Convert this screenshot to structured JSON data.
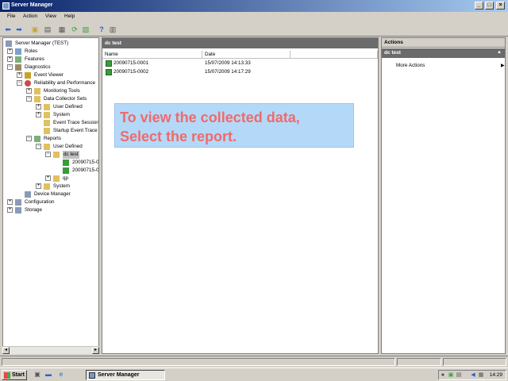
{
  "window": {
    "title": "Server Manager",
    "minimize": "_",
    "maximize": "□",
    "close": "×"
  },
  "menu": [
    "File",
    "Action",
    "View",
    "Help"
  ],
  "tree": {
    "nodes": [
      {
        "label": "Server Manager (TEST)"
      },
      {
        "label": "Roles"
      },
      {
        "label": "Features"
      },
      {
        "label": "Diagnostics"
      },
      {
        "label": "Event Viewer"
      },
      {
        "label": "Reliability and Performance"
      },
      {
        "label": "Monitoring Tools"
      },
      {
        "label": "Data Collector Sets"
      },
      {
        "label": "User Defined"
      },
      {
        "label": "System"
      },
      {
        "label": "Event Trace Sessions"
      },
      {
        "label": "Startup Event Trace"
      },
      {
        "label": "Reports"
      },
      {
        "label": "User Defined"
      },
      {
        "label": "dc test"
      },
      {
        "label": "20090715-0"
      },
      {
        "label": "20090715-0"
      },
      {
        "label": "qp"
      },
      {
        "label": "System"
      },
      {
        "label": "Device Manager"
      },
      {
        "label": "Configuration"
      },
      {
        "label": "Storage"
      }
    ]
  },
  "center": {
    "title": "dc test",
    "columns": [
      "Name",
      "Date"
    ],
    "rows": [
      {
        "name": "20090715-0001",
        "date": "15/07/2009 14:13:33"
      },
      {
        "name": "20090715-0002",
        "date": "15/07/2009 14:17:29"
      }
    ],
    "overlay": {
      "line1": "To view the collected data,",
      "line2": "Select the report."
    }
  },
  "actions": {
    "title": "Actions",
    "section": "dc test",
    "more": "More Actions",
    "collapse": "▲",
    "more_arrow": "▶"
  },
  "taskbar": {
    "start": "Start",
    "task": "Server Manager",
    "clock": "14:29",
    "collapse_tray": "«"
  },
  "colors": {
    "title_bar": "#0a246a",
    "overlay_bg": "#b4d8f8",
    "overlay_text": "#f06a6a",
    "pane_header": "#6b6b6b"
  }
}
